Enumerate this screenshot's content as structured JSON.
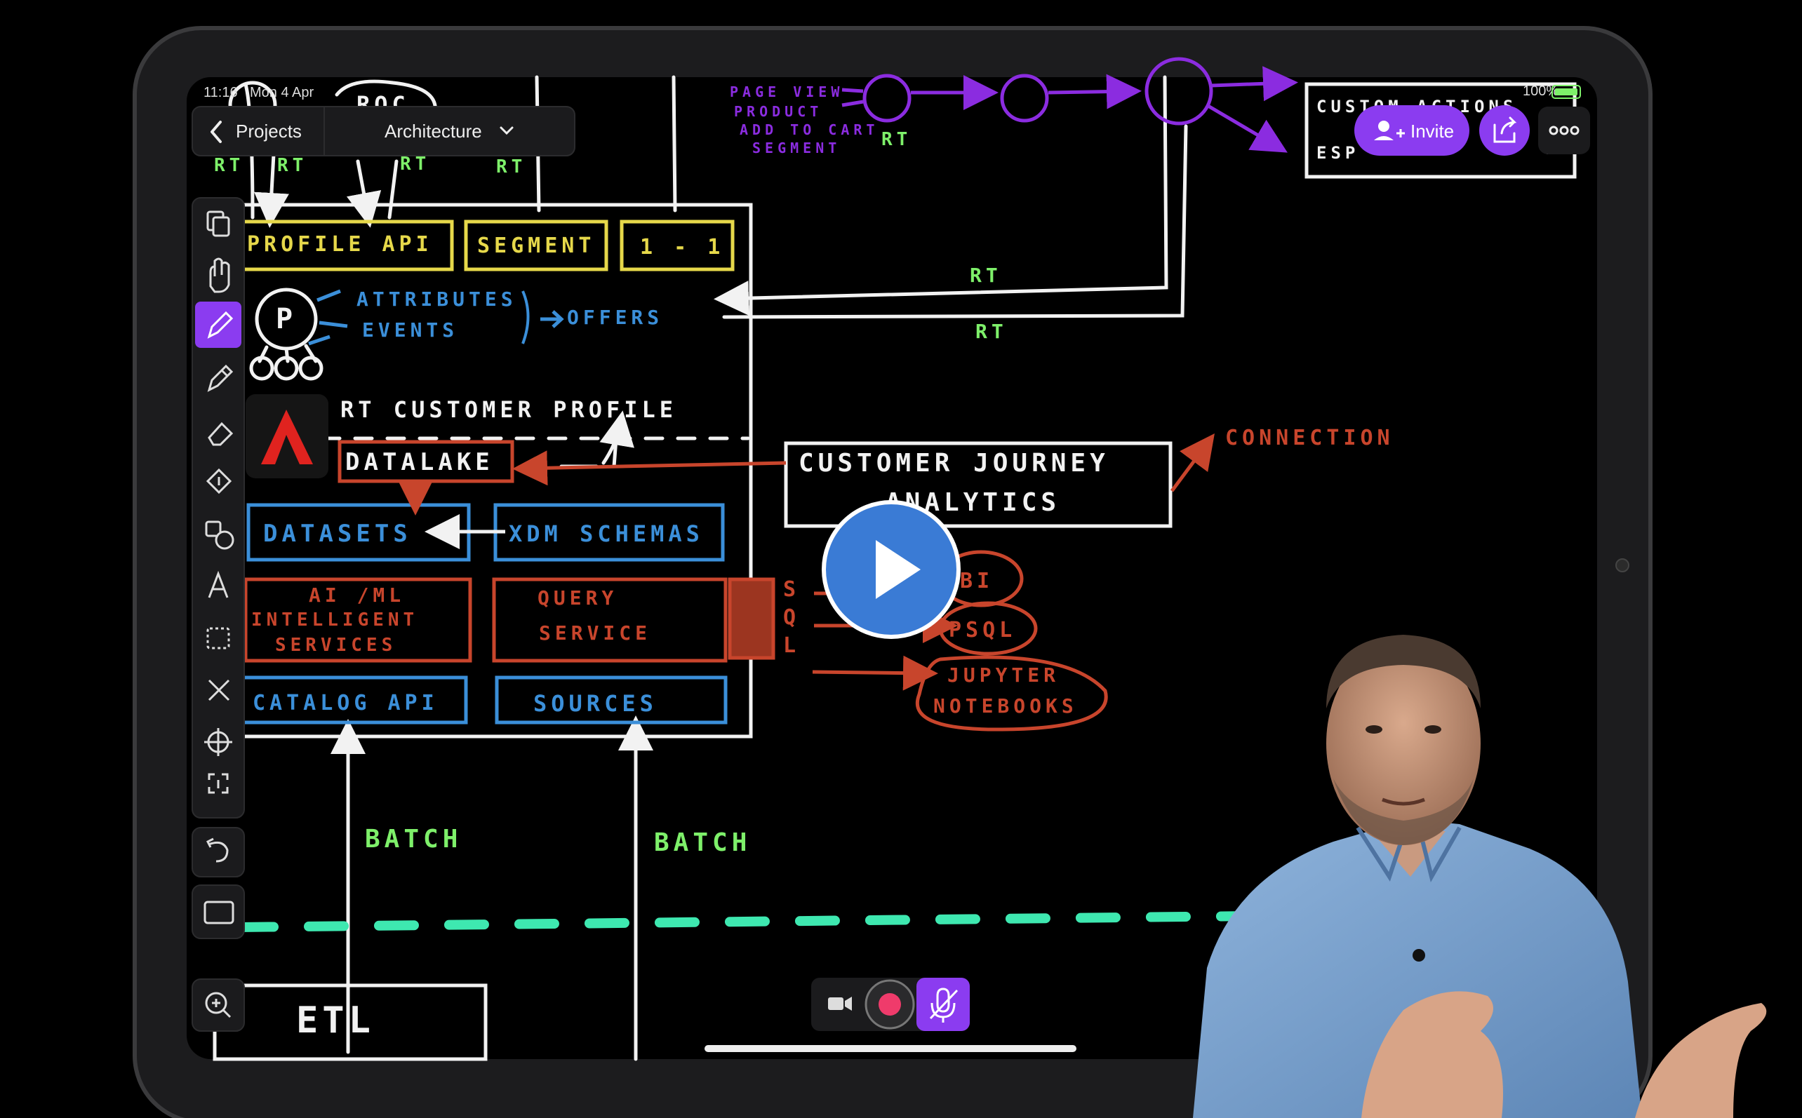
{
  "status_bar": {
    "time": "11:16",
    "date": "Mon 4 Apr",
    "battery": "100%"
  },
  "nav": {
    "back_label": "Projects",
    "title": "Architecture"
  },
  "actions": {
    "invite_label": "Invite"
  },
  "colors": {
    "canvas": "#000000",
    "white_ink": "#f2f2f2",
    "yellow_ink": "#e6d84a",
    "blue_ink": "#3b8fd9",
    "red_ink": "#c8452c",
    "green_ink": "#7ef06a",
    "mint_ink": "#3ee8b0",
    "purple_ink": "#8b2ce0",
    "accent": "#8b3cf0",
    "play_button": "#3a7bd5"
  },
  "toolbar": {
    "tools": [
      "copy-add",
      "hand",
      "pen",
      "highlighter",
      "eraser",
      "fill",
      "shapes",
      "text",
      "select",
      "close",
      "target",
      "info",
      "undo",
      "frame"
    ],
    "active": "pen"
  },
  "diagram": {
    "top_left": {
      "roc": "ROC",
      "rt_labels": [
        "RT",
        "RT",
        "RT",
        "RT"
      ]
    },
    "top_purple": {
      "events": [
        "PAGE VIEW",
        "PRODUCT",
        "ADD TO CART",
        "SEGMENT"
      ],
      "rt": "RT"
    },
    "custom_box": {
      "line1": "CUSTOM ACTIONS",
      "line2a": "ESP",
      "line2b": "A"
    },
    "api_boxes": [
      "PROFILE API",
      "SEGMENT",
      "1 - 1"
    ],
    "profile_icon": "P",
    "attributes": [
      "ATTRIBUTES",
      "EVENTS"
    ],
    "offers": "OFFERS",
    "rt_arrows": [
      "RT",
      "RT"
    ],
    "rt_customer_profile": "RT CUSTOMER   PROFILE",
    "datalake": "DATALAKE",
    "blue_boxes": [
      "DATASETS",
      "XDM SCHEMAS",
      "CATALOG API",
      "SOURCES"
    ],
    "red_boxes": {
      "ai_ml": [
        "AI /ML",
        "INTELLIGENT",
        "SERVICES"
      ],
      "query": [
        "QUERY",
        "SERVICE"
      ]
    },
    "sql": [
      "S",
      "Q",
      "L"
    ],
    "bubbles": [
      "BI",
      "PSQL",
      "JUPYTER",
      "NOTEBOOKS"
    ],
    "cja": [
      "CUSTOMER JOURNEY",
      "ANALYTICS"
    ],
    "connection": "CONNECTION",
    "batch_labels": [
      "BATCH",
      "BATCH"
    ],
    "etl": "ETL"
  }
}
